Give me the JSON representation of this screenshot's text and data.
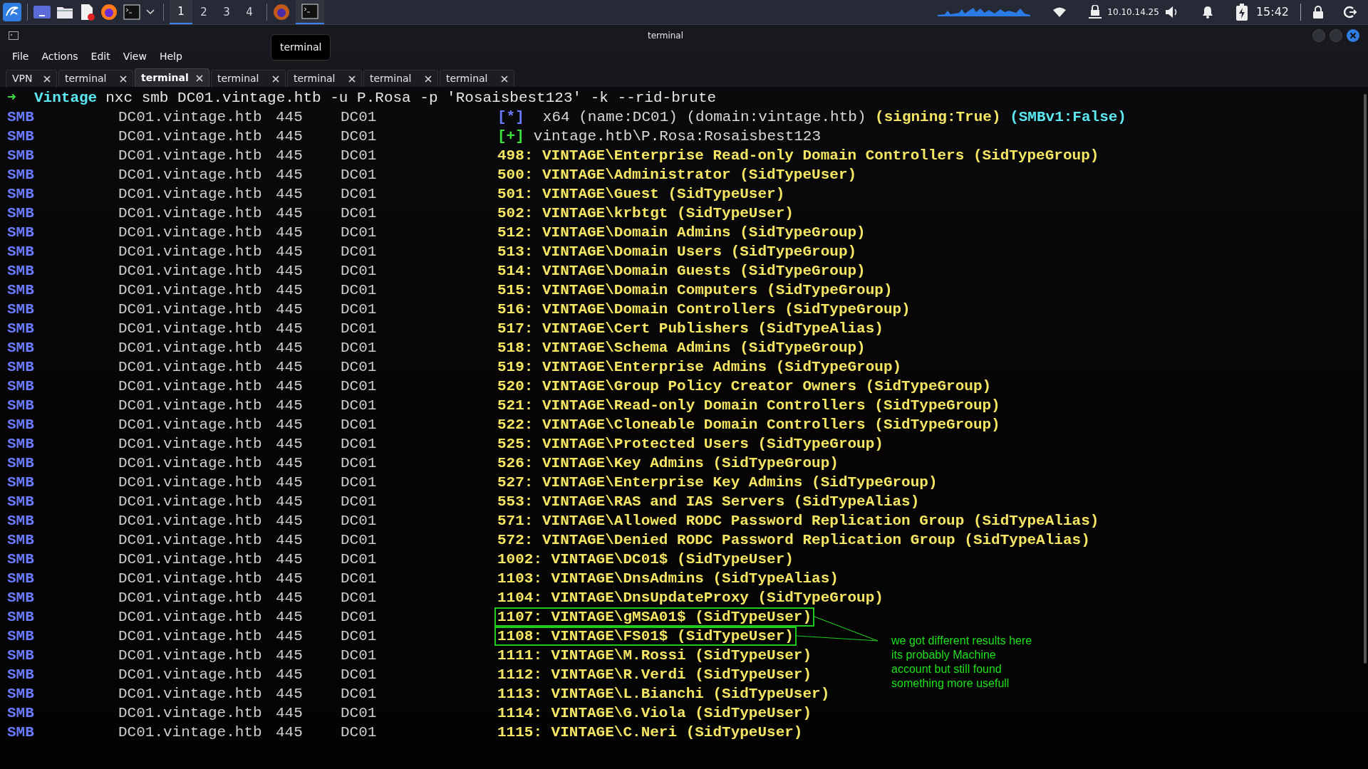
{
  "taskbar": {
    "workspaces": [
      {
        "label": "1",
        "selected": true
      },
      {
        "label": "2",
        "selected": false
      },
      {
        "label": "3",
        "selected": false
      },
      {
        "label": "4",
        "selected": false
      }
    ],
    "ip": "10.10.14.25",
    "clock": "15:42"
  },
  "tooltip": "terminal",
  "window": {
    "title": "terminal"
  },
  "menu": [
    "File",
    "Actions",
    "Edit",
    "View",
    "Help"
  ],
  "tabs": [
    {
      "label": "VPN",
      "selected": false
    },
    {
      "label": "terminal",
      "selected": false
    },
    {
      "label": "terminal",
      "selected": true
    },
    {
      "label": "terminal",
      "selected": false
    },
    {
      "label": "terminal",
      "selected": false
    },
    {
      "label": "terminal",
      "selected": false
    },
    {
      "label": "terminal",
      "selected": false
    }
  ],
  "prompt": {
    "arrow": "➜",
    "dir": "Vintage",
    "command": "nxc smb DC01.vintage.htb -u P.Rosa -p 'Rosaisbest123' -k --rid-brute"
  },
  "rows": [
    {
      "proto": "SMB",
      "host": "DC01.vintage.htb",
      "port": "445",
      "name": "DC01",
      "kind": "info",
      "marker": "[*]",
      "parts": [
        {
          "text": "x64 (name:DC01) (domain:vintage.htb) ",
          "kind": "plain"
        },
        {
          "text": "(signing:True)",
          "kind": "yellow"
        },
        {
          "text": " (SMBv1:False)",
          "kind": "cyan"
        }
      ],
      "highlighted": false
    },
    {
      "proto": "SMB",
      "host": "DC01.vintage.htb",
      "port": "445",
      "name": "DC01",
      "kind": "success",
      "marker": "[+]",
      "parts": [
        {
          "text": "vintage.htb\\P.Rosa:Rosaisbest123",
          "kind": "plain"
        }
      ],
      "highlighted": false
    },
    {
      "proto": "SMB",
      "host": "DC01.vintage.htb",
      "port": "445",
      "name": "DC01",
      "kind": "result",
      "text": "498: VINTAGE\\Enterprise Read-only Domain Controllers (SidTypeGroup)",
      "highlighted": false
    },
    {
      "proto": "SMB",
      "host": "DC01.vintage.htb",
      "port": "445",
      "name": "DC01",
      "kind": "result",
      "text": "500: VINTAGE\\Administrator (SidTypeUser)",
      "highlighted": false
    },
    {
      "proto": "SMB",
      "host": "DC01.vintage.htb",
      "port": "445",
      "name": "DC01",
      "kind": "result",
      "text": "501: VINTAGE\\Guest (SidTypeUser)",
      "highlighted": false
    },
    {
      "proto": "SMB",
      "host": "DC01.vintage.htb",
      "port": "445",
      "name": "DC01",
      "kind": "result",
      "text": "502: VINTAGE\\krbtgt (SidTypeUser)",
      "highlighted": false
    },
    {
      "proto": "SMB",
      "host": "DC01.vintage.htb",
      "port": "445",
      "name": "DC01",
      "kind": "result",
      "text": "512: VINTAGE\\Domain Admins (SidTypeGroup)",
      "highlighted": false
    },
    {
      "proto": "SMB",
      "host": "DC01.vintage.htb",
      "port": "445",
      "name": "DC01",
      "kind": "result",
      "text": "513: VINTAGE\\Domain Users (SidTypeGroup)",
      "highlighted": false
    },
    {
      "proto": "SMB",
      "host": "DC01.vintage.htb",
      "port": "445",
      "name": "DC01",
      "kind": "result",
      "text": "514: VINTAGE\\Domain Guests (SidTypeGroup)",
      "highlighted": false
    },
    {
      "proto": "SMB",
      "host": "DC01.vintage.htb",
      "port": "445",
      "name": "DC01",
      "kind": "result",
      "text": "515: VINTAGE\\Domain Computers (SidTypeGroup)",
      "highlighted": false
    },
    {
      "proto": "SMB",
      "host": "DC01.vintage.htb",
      "port": "445",
      "name": "DC01",
      "kind": "result",
      "text": "516: VINTAGE\\Domain Controllers (SidTypeGroup)",
      "highlighted": false
    },
    {
      "proto": "SMB",
      "host": "DC01.vintage.htb",
      "port": "445",
      "name": "DC01",
      "kind": "result",
      "text": "517: VINTAGE\\Cert Publishers (SidTypeAlias)",
      "highlighted": false
    },
    {
      "proto": "SMB",
      "host": "DC01.vintage.htb",
      "port": "445",
      "name": "DC01",
      "kind": "result",
      "text": "518: VINTAGE\\Schema Admins (SidTypeGroup)",
      "highlighted": false
    },
    {
      "proto": "SMB",
      "host": "DC01.vintage.htb",
      "port": "445",
      "name": "DC01",
      "kind": "result",
      "text": "519: VINTAGE\\Enterprise Admins (SidTypeGroup)",
      "highlighted": false
    },
    {
      "proto": "SMB",
      "host": "DC01.vintage.htb",
      "port": "445",
      "name": "DC01",
      "kind": "result",
      "text": "520: VINTAGE\\Group Policy Creator Owners (SidTypeGroup)",
      "highlighted": false
    },
    {
      "proto": "SMB",
      "host": "DC01.vintage.htb",
      "port": "445",
      "name": "DC01",
      "kind": "result",
      "text": "521: VINTAGE\\Read-only Domain Controllers (SidTypeGroup)",
      "highlighted": false
    },
    {
      "proto": "SMB",
      "host": "DC01.vintage.htb",
      "port": "445",
      "name": "DC01",
      "kind": "result",
      "text": "522: VINTAGE\\Cloneable Domain Controllers (SidTypeGroup)",
      "highlighted": false
    },
    {
      "proto": "SMB",
      "host": "DC01.vintage.htb",
      "port": "445",
      "name": "DC01",
      "kind": "result",
      "text": "525: VINTAGE\\Protected Users (SidTypeGroup)",
      "highlighted": false
    },
    {
      "proto": "SMB",
      "host": "DC01.vintage.htb",
      "port": "445",
      "name": "DC01",
      "kind": "result",
      "text": "526: VINTAGE\\Key Admins (SidTypeGroup)",
      "highlighted": false
    },
    {
      "proto": "SMB",
      "host": "DC01.vintage.htb",
      "port": "445",
      "name": "DC01",
      "kind": "result",
      "text": "527: VINTAGE\\Enterprise Key Admins (SidTypeGroup)",
      "highlighted": false
    },
    {
      "proto": "SMB",
      "host": "DC01.vintage.htb",
      "port": "445",
      "name": "DC01",
      "kind": "result",
      "text": "553: VINTAGE\\RAS and IAS Servers (SidTypeAlias)",
      "highlighted": false
    },
    {
      "proto": "SMB",
      "host": "DC01.vintage.htb",
      "port": "445",
      "name": "DC01",
      "kind": "result",
      "text": "571: VINTAGE\\Allowed RODC Password Replication Group (SidTypeAlias)",
      "highlighted": false
    },
    {
      "proto": "SMB",
      "host": "DC01.vintage.htb",
      "port": "445",
      "name": "DC01",
      "kind": "result",
      "text": "572: VINTAGE\\Denied RODC Password Replication Group (SidTypeAlias)",
      "highlighted": false
    },
    {
      "proto": "SMB",
      "host": "DC01.vintage.htb",
      "port": "445",
      "name": "DC01",
      "kind": "result",
      "text": "1002: VINTAGE\\DC01$ (SidTypeUser)",
      "highlighted": false
    },
    {
      "proto": "SMB",
      "host": "DC01.vintage.htb",
      "port": "445",
      "name": "DC01",
      "kind": "result",
      "text": "1103: VINTAGE\\DnsAdmins (SidTypeAlias)",
      "highlighted": false
    },
    {
      "proto": "SMB",
      "host": "DC01.vintage.htb",
      "port": "445",
      "name": "DC01",
      "kind": "result",
      "text": "1104: VINTAGE\\DnsUpdateProxy (SidTypeGroup)",
      "highlighted": false
    },
    {
      "proto": "SMB",
      "host": "DC01.vintage.htb",
      "port": "445",
      "name": "DC01",
      "kind": "result",
      "text": "1107: VINTAGE\\gMSA01$ (SidTypeUser)",
      "highlighted": true
    },
    {
      "proto": "SMB",
      "host": "DC01.vintage.htb",
      "port": "445",
      "name": "DC01",
      "kind": "result",
      "text": "1108: VINTAGE\\FS01$ (SidTypeUser)",
      "highlighted": true
    },
    {
      "proto": "SMB",
      "host": "DC01.vintage.htb",
      "port": "445",
      "name": "DC01",
      "kind": "result",
      "text": "1111: VINTAGE\\M.Rossi (SidTypeUser)",
      "highlighted": false
    },
    {
      "proto": "SMB",
      "host": "DC01.vintage.htb",
      "port": "445",
      "name": "DC01",
      "kind": "result",
      "text": "1112: VINTAGE\\R.Verdi (SidTypeUser)",
      "highlighted": false
    },
    {
      "proto": "SMB",
      "host": "DC01.vintage.htb",
      "port": "445",
      "name": "DC01",
      "kind": "result",
      "text": "1113: VINTAGE\\L.Bianchi (SidTypeUser)",
      "highlighted": false
    },
    {
      "proto": "SMB",
      "host": "DC01.vintage.htb",
      "port": "445",
      "name": "DC01",
      "kind": "result",
      "text": "1114: VINTAGE\\G.Viola (SidTypeUser)",
      "highlighted": false
    },
    {
      "proto": "SMB",
      "host": "DC01.vintage.htb",
      "port": "445",
      "name": "DC01",
      "kind": "result",
      "text": "1115: VINTAGE\\C.Neri (SidTypeUser)",
      "highlighted": false
    }
  ],
  "annotation": [
    "we got different results here",
    "its probably Machine",
    "account but still found",
    "something more usefull"
  ]
}
